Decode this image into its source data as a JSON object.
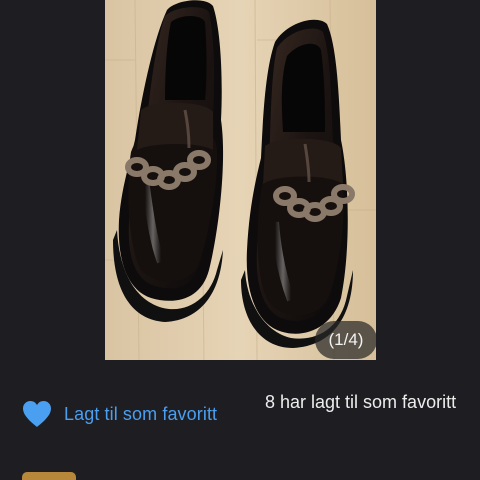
{
  "gallery": {
    "counter": "(1/4)",
    "photo_icon": "product-photo"
  },
  "favorite": {
    "label": "Lagt til som favoritt",
    "count_text": "8 har lagt til som favoritt",
    "icon": "heart-icon",
    "color": "#4a9ff0"
  }
}
